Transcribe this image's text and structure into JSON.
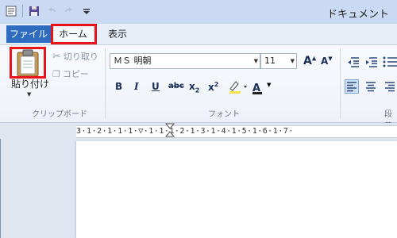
{
  "titlebar": {
    "doc_title": "ドキュメント",
    "qat_icons": [
      "app-icon",
      "save-icon",
      "undo-icon",
      "redo-icon",
      "customize-qat-icon"
    ]
  },
  "tabs": [
    {
      "label": "ファイル"
    },
    {
      "label": "ホーム"
    },
    {
      "label": "表示"
    }
  ],
  "clipboard": {
    "paste_label": "貼り付け",
    "cut_label": "切り取り",
    "copy_label": "コピー",
    "group_label": "クリップボード"
  },
  "font": {
    "font_name": "ＭＳ 明朝",
    "font_size": "11",
    "grow_label": "A",
    "shrink_label": "A",
    "bold": "B",
    "italic": "I",
    "underline": "U",
    "strike": "abc",
    "subscript": "x",
    "subscript_mark": "2",
    "superscript": "x",
    "superscript_mark": "2",
    "font_color": "A",
    "group_label": "フォント"
  },
  "paragraph": {
    "group_label": "段落"
  },
  "ruler": {
    "text": "3·1·2·1·1·1·▽·1·1·1·2·1·3·1·4·1·5·1·6·1·7·"
  },
  "colors": {
    "file_tab": "#2f6cc0",
    "highlight": "#e8141a"
  }
}
